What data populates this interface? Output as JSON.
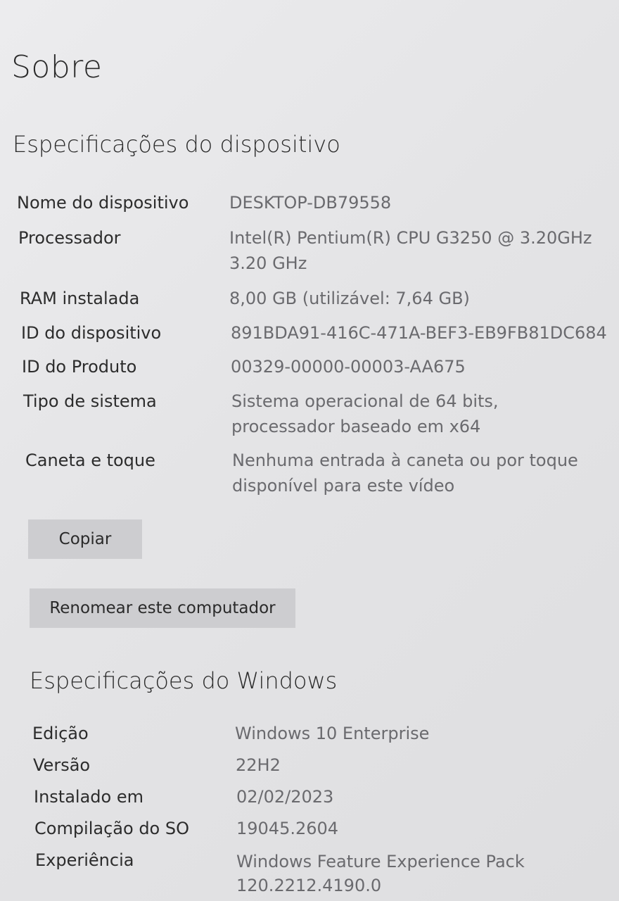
{
  "page": {
    "title": "Sobre"
  },
  "device_specs": {
    "title": "Especificações do dispositivo",
    "rows": [
      {
        "label": "Nome do dispositivo",
        "value": [
          "DESKTOP-DB79558"
        ]
      },
      {
        "label": "Processador",
        "value": [
          "Intel(R) Pentium(R) CPU G3250 @ 3.20GHz",
          "3.20 GHz"
        ]
      },
      {
        "label": "RAM instalada",
        "value": [
          "8,00 GB (utilizável: 7,64 GB)"
        ]
      },
      {
        "label": "ID do dispositivo",
        "value": [
          "891BDA91-416C-471A-BEF3-EB9FB81DC684"
        ]
      },
      {
        "label": "ID do Produto",
        "value": [
          "00329-00000-00003-AA675"
        ]
      },
      {
        "label": "Tipo de sistema",
        "value": [
          "Sistema operacional de 64 bits,",
          "processador baseado em x64"
        ]
      },
      {
        "label": "Caneta e toque",
        "value": [
          "Nenhuma entrada à caneta ou por toque",
          "disponível para este vídeo"
        ]
      }
    ],
    "copy_button": "Copiar",
    "rename_button": "Renomear este computador"
  },
  "windows_specs": {
    "title": "Especificações do Windows",
    "rows": [
      {
        "label": "Edição",
        "value": [
          "Windows 10 Enterprise"
        ]
      },
      {
        "label": "Versão",
        "value": [
          "22H2"
        ]
      },
      {
        "label": "Instalado em",
        "value": [
          "02/02/2023"
        ]
      },
      {
        "label": "Compilação do SO",
        "value": [
          "19045.2604"
        ]
      },
      {
        "label": "Experiência",
        "value": [
          "Windows Feature Experience Pack",
          "120.2212.4190.0"
        ]
      }
    ]
  }
}
